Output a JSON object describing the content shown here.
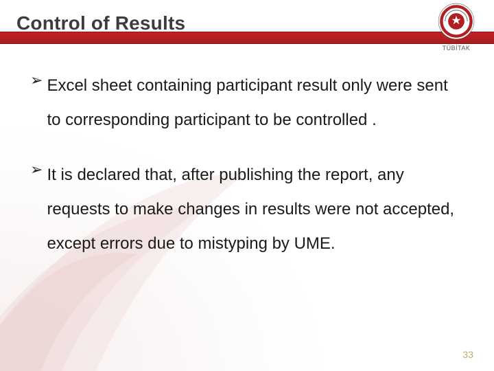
{
  "header": {
    "title": "Control of Results",
    "org": "TÜBİTAK"
  },
  "bullets": [
    "Excel sheet containing participant result only were sent to corresponding participant to be controlled .",
    "It is declared that, after publishing the report, any requests to make changes in results were not accepted, except errors due to mistyping by UME."
  ],
  "page_number": "33",
  "colors": {
    "accent_red": "#b01f22",
    "swoosh_light": "#f3e6e6"
  }
}
